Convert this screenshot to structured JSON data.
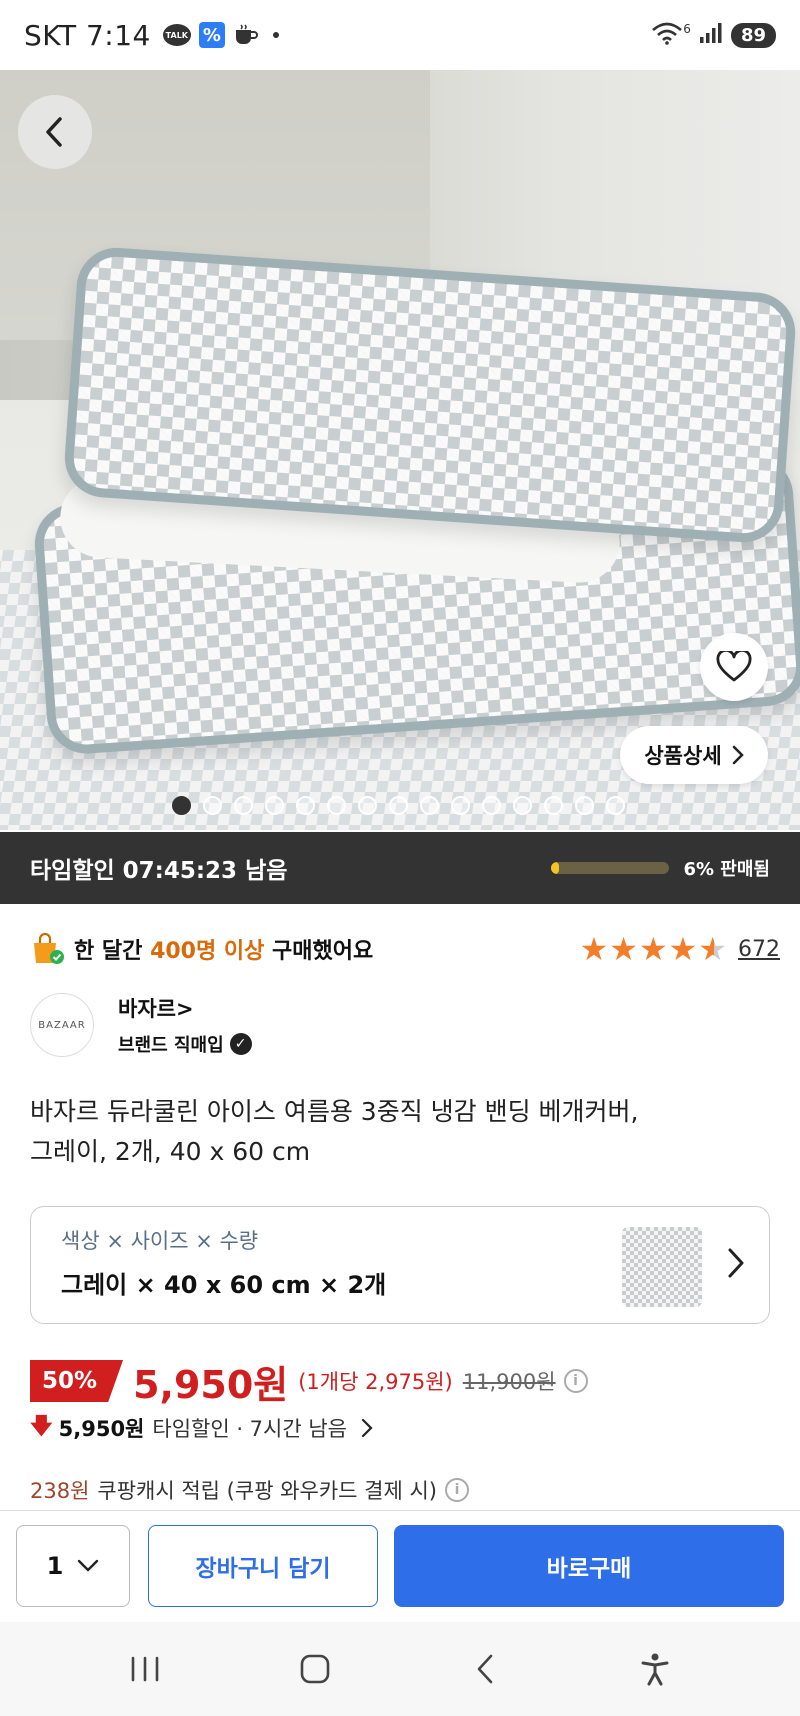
{
  "status_bar": {
    "carrier_time": "SKT 7:14",
    "talk_badge": "TALK",
    "network_label": "6",
    "battery": "89"
  },
  "hero": {
    "image_count": 15,
    "active_index": 0,
    "detail_button_label": "상품상세"
  },
  "time_sale": {
    "label": "타임할인 07:45:23 남음",
    "sold_percent": 6,
    "sold_label": "6% 판매됨"
  },
  "purchase_info": {
    "prefix": "한 달간",
    "highlight": "400명 이상",
    "suffix": "구매했어요",
    "rating": 4.5,
    "review_count": "672"
  },
  "seller": {
    "logo_text": "BAZAAR",
    "name": "바자르>",
    "subtitle": "브랜드 직매입"
  },
  "product": {
    "title_line1": "바자르 듀라쿨린 아이스 여름용 3중직 냉감 밴딩 베개커버,",
    "title_line2": "그레이, 2개, 40 x 60 cm"
  },
  "option": {
    "label": "색상 × 사이즈 × 수량",
    "value": "그레이 × 40 x 60 cm × 2개"
  },
  "price": {
    "discount": "50%",
    "sale_price": "5,950원",
    "unit_price": "(1개당 2,975원)",
    "original_price": "11,900원",
    "timesale_price": "5,950원",
    "timesale_text": "타임할인 · 7시간 남음",
    "cash_amount": "238원",
    "cash_text": "쿠팡캐시 적립 (쿠팡 와우카드 결제 시)"
  },
  "actions": {
    "quantity": "1",
    "cart_label": "장바구니 담기",
    "buy_label": "바로구매"
  },
  "colors": {
    "accent_blue": "#2e6ee8",
    "sale_red": "#d11f1f",
    "star_orange": "#f47d2a",
    "progress_yellow": "#f3c623"
  }
}
